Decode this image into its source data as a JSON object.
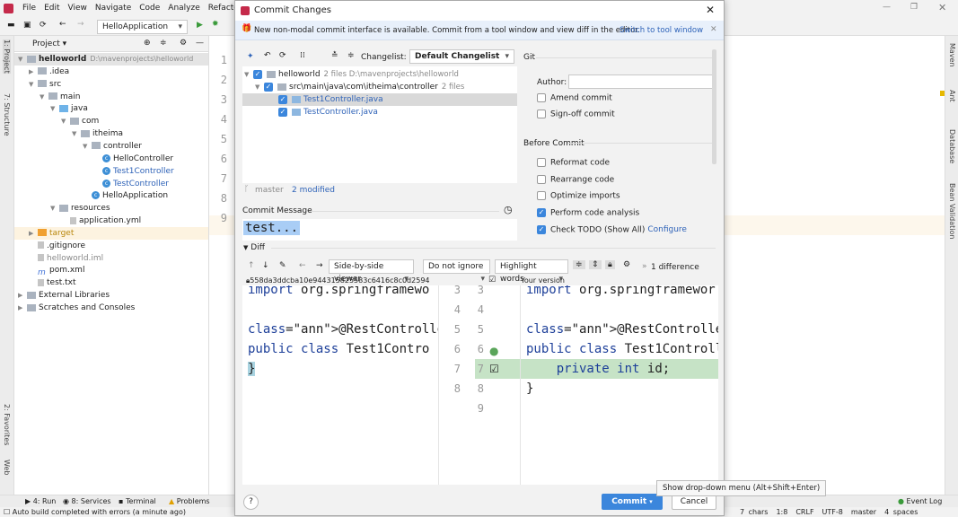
{
  "ide": {
    "menu": [
      "File",
      "Edit",
      "View",
      "Navigate",
      "Code",
      "Analyze",
      "Refactor"
    ],
    "run_config": "HelloApplication",
    "project_header": "Project",
    "left_stripe": [
      "1: Project",
      "7: Structure",
      "2: Favorites",
      "Web"
    ],
    "right_stripe": [
      "Maven",
      "Ant",
      "Database",
      "Bean Validation"
    ],
    "tree": [
      {
        "label": "helloworld",
        "path": "D:\\mavenprojects\\helloworld",
        "depth": 0,
        "type": "module",
        "open": true
      },
      {
        "label": ".idea",
        "depth": 1,
        "type": "folder",
        "open": false
      },
      {
        "label": "src",
        "depth": 1,
        "type": "folder",
        "open": true
      },
      {
        "label": "main",
        "depth": 2,
        "type": "folder",
        "open": true
      },
      {
        "label": "java",
        "depth": 3,
        "type": "source",
        "open": true
      },
      {
        "label": "com",
        "depth": 4,
        "type": "folder",
        "open": true
      },
      {
        "label": "itheima",
        "depth": 5,
        "type": "folder",
        "open": true
      },
      {
        "label": "controller",
        "depth": 6,
        "type": "folder",
        "open": true
      },
      {
        "label": "HelloController",
        "depth": 7,
        "type": "class"
      },
      {
        "label": "Test1Controller",
        "depth": 7,
        "type": "class",
        "modified": true
      },
      {
        "label": "TestController",
        "depth": 7,
        "type": "class",
        "modified": true
      },
      {
        "label": "HelloApplication",
        "depth": 6,
        "type": "class"
      },
      {
        "label": "resources",
        "depth": 3,
        "type": "folder",
        "open": true
      },
      {
        "label": "application.yml",
        "depth": 4,
        "type": "file"
      },
      {
        "label": "target",
        "depth": 1,
        "type": "excluded",
        "open": false
      },
      {
        "label": ".gitignore",
        "depth": 1,
        "type": "file"
      },
      {
        "label": "helloworld.iml",
        "depth": 1,
        "type": "file",
        "muted": true
      },
      {
        "label": "pom.xml",
        "depth": 1,
        "type": "maven"
      },
      {
        "label": "test.txt",
        "depth": 1,
        "type": "file"
      },
      {
        "label": "External Libraries",
        "depth": 0,
        "type": "lib",
        "open": false
      },
      {
        "label": "Scratches and Consoles",
        "depth": 0,
        "type": "scratch",
        "open": false
      }
    ],
    "editor_lines": [
      "1",
      "2",
      "3",
      "4",
      "5",
      "6",
      "7",
      "8",
      "9"
    ],
    "bottom_tabs": [
      "4: Run",
      "8: Services",
      "Terminal",
      "Problems"
    ],
    "event_log": "Event Log",
    "status_message": "Auto build completed with errors (a minute ago)",
    "status_right": [
      "7 chars",
      "1:8",
      "CRLF",
      "UTF-8",
      "master",
      "4 spaces"
    ]
  },
  "dialog": {
    "title": "Commit Changes",
    "notice": "New non-modal commit interface is available. Commit from a tool window and view diff in the editor.",
    "notice_link": "Switch to tool window",
    "changelist_label": "Changelist:",
    "changelist_value": "Default Changelist",
    "changes": [
      {
        "label": "helloworld",
        "meta": "2 files  D:\\mavenprojects\\helloworld",
        "checked": true
      },
      {
        "label": "src\\main\\java\\com\\itheima\\controller",
        "meta": "2 files",
        "checked": true
      },
      {
        "label": "Test1Controller.java",
        "checked": true,
        "selected": true
      },
      {
        "label": "TestController.java",
        "checked": true
      }
    ],
    "branch": "master",
    "modified": "2 modified",
    "commit_message_label": "Commit Message",
    "commit_message": "test...",
    "git_section": "Git",
    "author_label": "Author:",
    "author_value": "",
    "git_options": [
      {
        "label": "Amend commit",
        "checked": false
      },
      {
        "label": "Sign-off commit",
        "checked": false
      }
    ],
    "before_commit_section": "Before Commit",
    "before_commit": [
      {
        "label": "Reformat code",
        "checked": false
      },
      {
        "label": "Rearrange code",
        "checked": false
      },
      {
        "label": "Optimize imports",
        "checked": false
      },
      {
        "label": "Perform code analysis",
        "checked": true
      },
      {
        "label": "Check TODO (Show All)",
        "checked": true,
        "link": "Configure"
      }
    ],
    "diff_label": "Diff",
    "viewer": "Side-by-side viewer",
    "ignore": "Do not ignore",
    "highlight": "Highlight words",
    "differences": "1 difference",
    "left_header": "558da3ddcba10e944315825583c6416c8c0d2594",
    "right_header": "Your version",
    "left_lines": [
      "import org.springframewo",
      "",
      "@RestController",
      "public class Test1Contro",
      "}"
    ],
    "right_lines": [
      "import org.springframewor",
      "",
      "@RestController",
      "public class Test1Controll",
      "    private int id;",
      "}",
      ""
    ],
    "left_numbers": [
      "3",
      "4",
      "5",
      "6",
      "7",
      "8"
    ],
    "right_numbers": [
      "3",
      "4",
      "5",
      "6",
      "7",
      "8",
      "9"
    ],
    "commit_button": "Commit",
    "cancel_button": "Cancel",
    "tooltip": "Show drop-down menu (Alt+Shift+Enter)",
    "help": "?",
    "colors": {
      "accent": "#3b86dc",
      "added": "#c6e3c6",
      "link": "#2f63b8"
    }
  }
}
